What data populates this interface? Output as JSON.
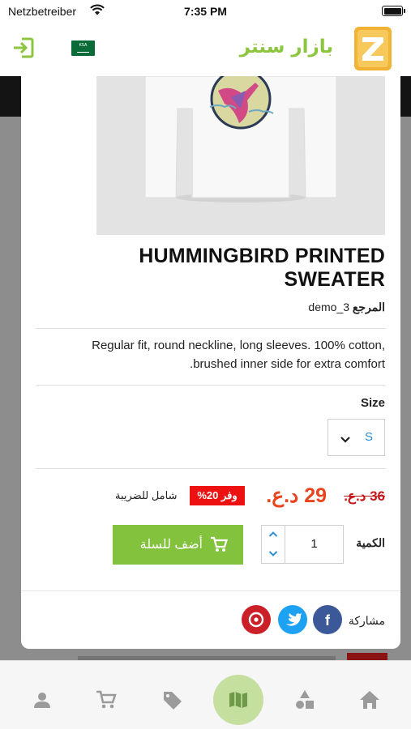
{
  "status_bar": {
    "carrier": "Netzbetreiber",
    "time": "7:35 PM"
  },
  "header": {
    "brand_name": "بازار سنتر",
    "flag_text": "KSA"
  },
  "product": {
    "title": "HUMMINGBIRD PRINTED SWEATER",
    "reference_label": "المرجع",
    "reference_value": "demo_3",
    "description": "Regular fit, round neckline, long sleeves. 100% cotton, brushed inner side for extra comfort.",
    "size_label": "Size",
    "size_value": "S",
    "old_price": "36 د.ع.",
    "new_price": "29 د.ع.",
    "discount": "وفر 20%",
    "tax_note": "شامل للضريبة",
    "quantity_label": "الكمية",
    "quantity_value": "1",
    "add_to_cart": "أضف للسلة",
    "share_label": "مشاركة"
  },
  "colors": {
    "accent_green": "#82c23c",
    "brand_green": "#8cc63f",
    "price_orange": "#e8451e",
    "discount_red": "#ee1111",
    "facebook": "#3b5998",
    "twitter": "#1da1f2",
    "pinterest": "#cb2027"
  },
  "icons": {
    "header": [
      "login-icon",
      "saudi-flag-icon",
      "z-logo-icon"
    ],
    "tabs": [
      "account-icon",
      "cart-icon",
      "tag-icon",
      "map-icon",
      "categories-icon",
      "home-icon"
    ],
    "social": [
      "facebook-icon",
      "twitter-icon",
      "pinterest-icon"
    ]
  }
}
